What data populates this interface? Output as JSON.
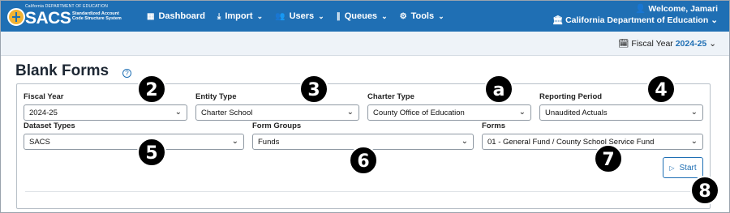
{
  "header": {
    "logo": {
      "top_text": "California DEPARTMENT OF EDUCATION",
      "main": "SACS",
      "sub": "Standardized Account Code Structure System"
    },
    "nav": [
      {
        "label": "Dashboard",
        "icon": "dashboard-icon",
        "has_menu": false
      },
      {
        "label": "Import",
        "icon": "import-icon",
        "has_menu": true
      },
      {
        "label": "Users",
        "icon": "users-icon",
        "has_menu": true
      },
      {
        "label": "Queues",
        "icon": "queues-icon",
        "has_menu": true
      },
      {
        "label": "Tools",
        "icon": "tools-icon",
        "has_menu": true
      }
    ],
    "welcome": "Welcome, Jamari",
    "org": "California Department of Education"
  },
  "fiscal_bar": {
    "label": "Fiscal Year",
    "value": "2024-25"
  },
  "page": {
    "title": "Blank Forms"
  },
  "filters": {
    "fiscal_year": {
      "label": "Fiscal Year",
      "value": "2024-25"
    },
    "entity_type": {
      "label": "Entity Type",
      "value": "Charter School"
    },
    "charter_type": {
      "label": "Charter Type",
      "value": "County Office of Education"
    },
    "reporting_period": {
      "label": "Reporting Period",
      "value": "Unaudited Actuals"
    },
    "dataset_types": {
      "label": "Dataset Types",
      "value": "SACS"
    },
    "form_groups": {
      "label": "Form Groups",
      "value": "Funds"
    },
    "forms": {
      "label": "Forms",
      "value": "01 - General Fund / County School Service Fund"
    }
  },
  "start_label": "Start",
  "callouts": {
    "c2": "2",
    "c3": "3",
    "ca": "a",
    "c4": "4",
    "c5": "5",
    "c6": "6",
    "c7": "7",
    "c8": "8"
  },
  "colors": {
    "nav_bg": "#1f6fb4",
    "accent": "#1f6fb4"
  }
}
